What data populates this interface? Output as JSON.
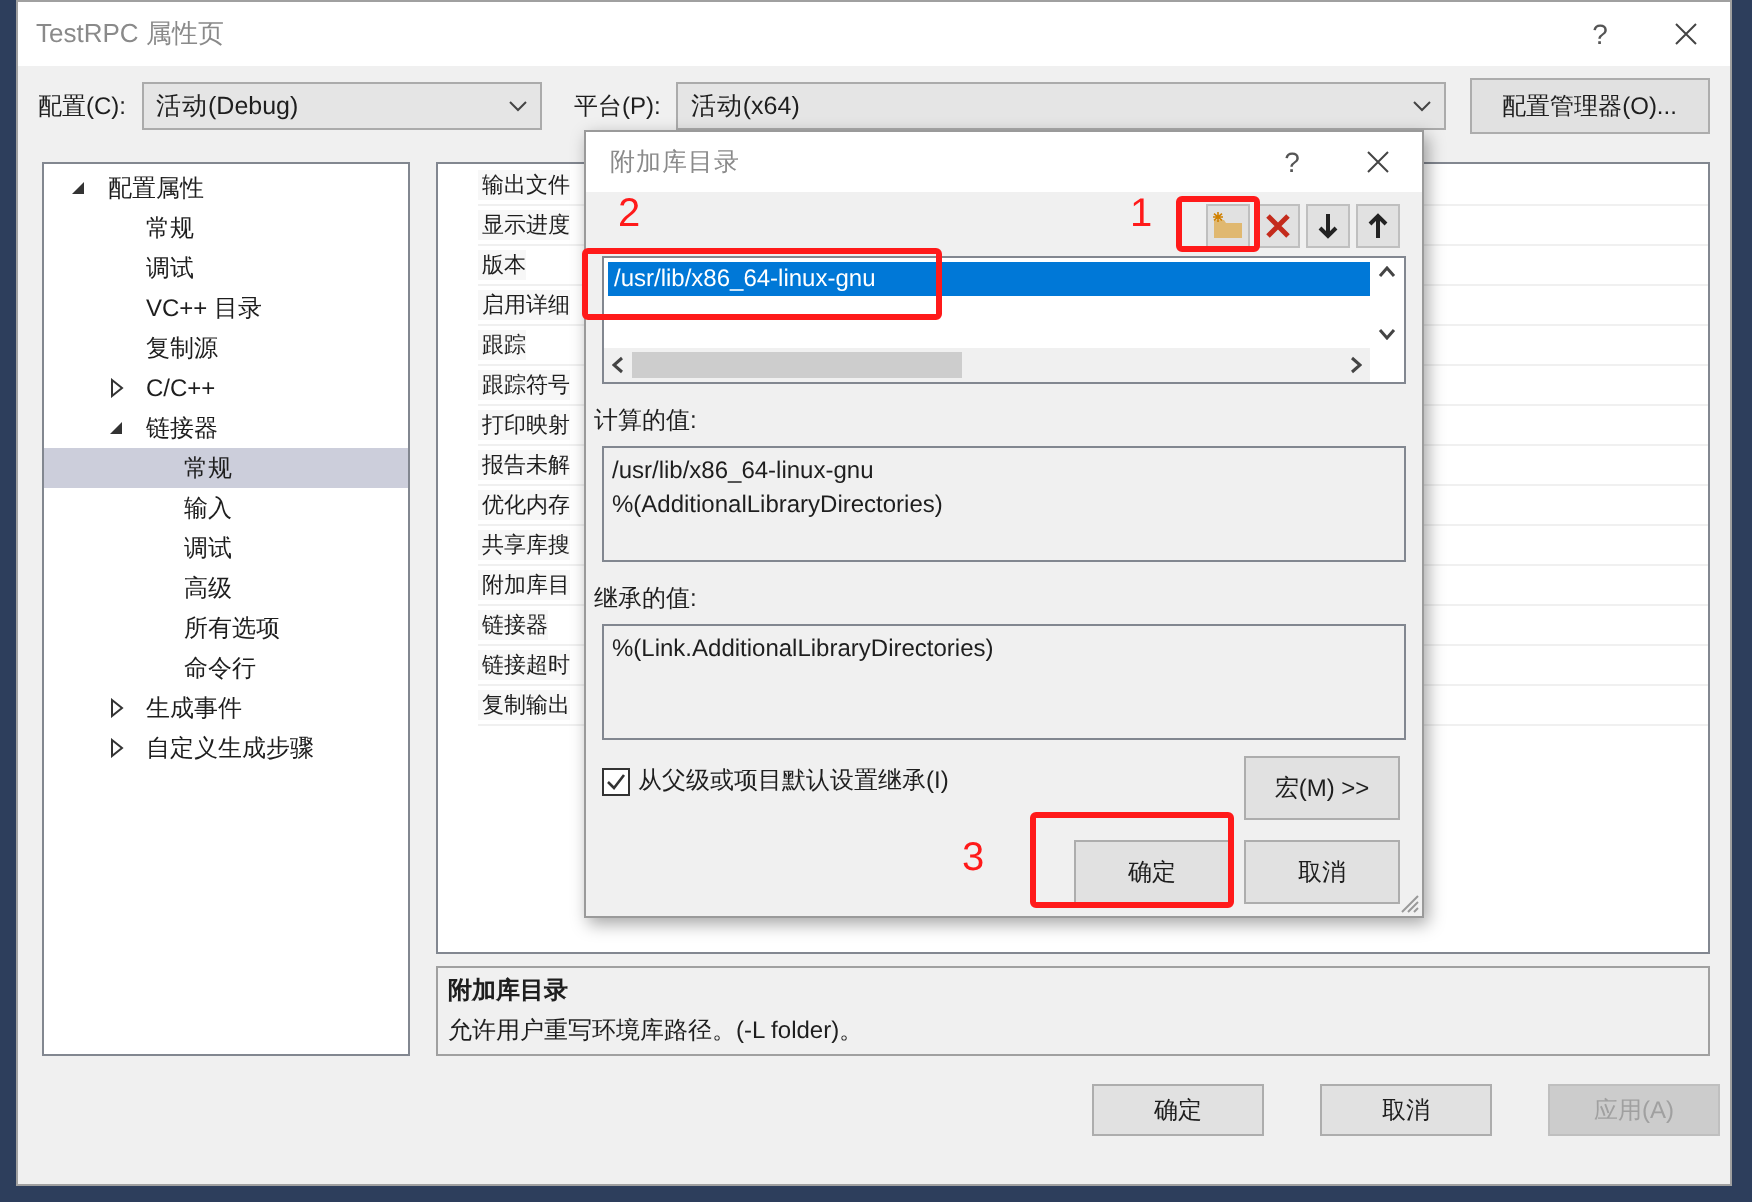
{
  "window": {
    "title": "TestRPC 属性页",
    "help": "?"
  },
  "config": {
    "label": "配置(C):",
    "value": "活动(Debug)"
  },
  "platform": {
    "label": "平台(P):",
    "value": "活动(x64)"
  },
  "config_manager_button": "配置管理器(O)...",
  "tree": [
    {
      "label": "配置属性",
      "expanded": true,
      "selected": false,
      "children": [
        {
          "label": "常规",
          "selected": false
        },
        {
          "label": "调试",
          "selected": false
        },
        {
          "label": "VC++ 目录",
          "selected": false
        },
        {
          "label": "复制源",
          "selected": false
        },
        {
          "label": "C/C++",
          "expanded": false,
          "selected": false
        },
        {
          "label": "链接器",
          "expanded": true,
          "selected": false,
          "children": [
            {
              "label": "常规",
              "selected": true
            },
            {
              "label": "输入",
              "selected": false
            },
            {
              "label": "调试",
              "selected": false
            },
            {
              "label": "高级",
              "selected": false
            },
            {
              "label": "所有选项",
              "selected": false
            },
            {
              "label": "命令行",
              "selected": false
            }
          ]
        },
        {
          "label": "生成事件",
          "expanded": false,
          "selected": false
        },
        {
          "label": "自定义生成步骤",
          "expanded": false,
          "selected": false
        }
      ]
    }
  ],
  "property_grid": [
    "输出文件",
    "显示进度",
    "版本",
    "启用详细",
    "跟踪",
    "跟踪符号",
    "打印映射",
    "报告未解",
    "优化内存",
    "共享库搜",
    "附加库目",
    "链接器",
    "链接超时",
    "复制输出"
  ],
  "description": {
    "title": "附加库目录",
    "text": "允许用户重写环境库路径。(-L folder)。"
  },
  "buttons": [
    {
      "label": "确定",
      "disabled": false
    },
    {
      "label": "取消",
      "disabled": false
    },
    {
      "label": "应用(A)",
      "disabled": true
    }
  ],
  "dialog": {
    "title": "附加库目录",
    "help": "?",
    "entries": [
      {
        "text": "/usr/lib/x86_64-linux-gnu",
        "selected": true
      }
    ],
    "computed_label": "计算的值:",
    "computed_lines": [
      "/usr/lib/x86_64-linux-gnu",
      "%(AdditionalLibraryDirectories)"
    ],
    "inherited_label": "继承的值:",
    "inherited_lines": [
      "%(Link.AdditionalLibraryDirectories)"
    ],
    "inherit_checkbox": {
      "label": "从父级或项目默认设置继承(I)",
      "checked": true
    },
    "macro_button": "宏(M) >>",
    "ok_button": "确定",
    "cancel_button": "取消"
  },
  "annotations": [
    "1",
    "2",
    "3"
  ]
}
